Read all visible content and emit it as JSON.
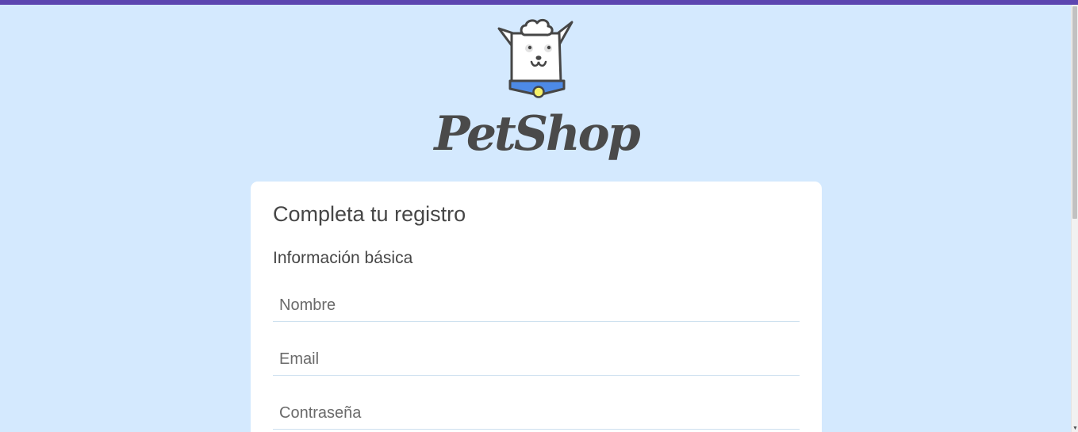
{
  "brand": {
    "name": "PetShop"
  },
  "form": {
    "title": "Completa tu registro",
    "section_title": "Información básica",
    "fields": {
      "name": {
        "placeholder": "Nombre",
        "value": ""
      },
      "email": {
        "placeholder": "Email",
        "value": ""
      },
      "password": {
        "placeholder": "Contraseña",
        "value": ""
      }
    }
  },
  "colors": {
    "accent_bar": "#5c45b0",
    "background": "#d4e9fe",
    "card": "#ffffff",
    "text": "#464646",
    "collar": "#4d8ae6",
    "tag": "#f6f26a"
  },
  "icons": {
    "logo": "dog-mascot-icon",
    "scroll_down": "scroll-down-arrow-icon"
  }
}
